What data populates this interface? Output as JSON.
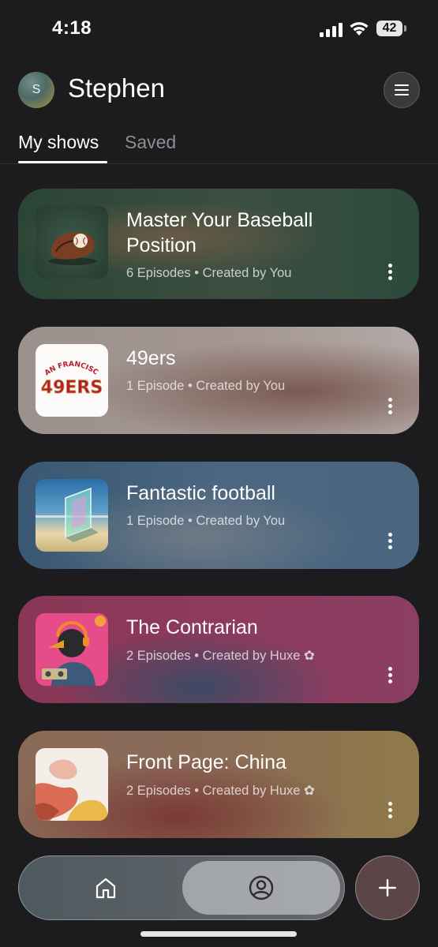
{
  "status_bar": {
    "time": "4:18",
    "battery": "42"
  },
  "header": {
    "avatar_initial": "S",
    "username": "Stephen"
  },
  "tabs": [
    {
      "label": "My shows"
    },
    {
      "label": "Saved"
    }
  ],
  "shows": [
    {
      "title": "Master Your Baseball Position",
      "episodes": "6 Episodes",
      "creator": "Created by You",
      "creator_badge": ""
    },
    {
      "title": "49ers",
      "episodes": "1 Episode",
      "creator": "Created by You",
      "creator_badge": ""
    },
    {
      "title": "Fantastic football",
      "episodes": "1 Episode",
      "creator": "Created by You",
      "creator_badge": ""
    },
    {
      "title": "The Contrarian",
      "episodes": "2 Episodes",
      "creator": "Created by Huxe",
      "creator_badge": "✿"
    },
    {
      "title": "Front Page: China",
      "episodes": "2 Episodes",
      "creator": "Created by Huxe",
      "creator_badge": "✿"
    }
  ],
  "thumbnail_text": {
    "sf_logo_arc": "SAN FRANCISCO",
    "sf_logo_number": "49ERS"
  },
  "bottom_nav": {
    "items": [
      {
        "icon": "home-icon"
      },
      {
        "icon": "profile-icon"
      }
    ],
    "add_icon": "plus-icon"
  },
  "colors": {
    "background": "#1c1c1e",
    "card_baseball": "#2f4a3c",
    "card_49ers": "#a89a94",
    "card_football": "#3f5b75",
    "card_contrarian": "#8b3a5a",
    "card_china": "#8c6a55"
  }
}
